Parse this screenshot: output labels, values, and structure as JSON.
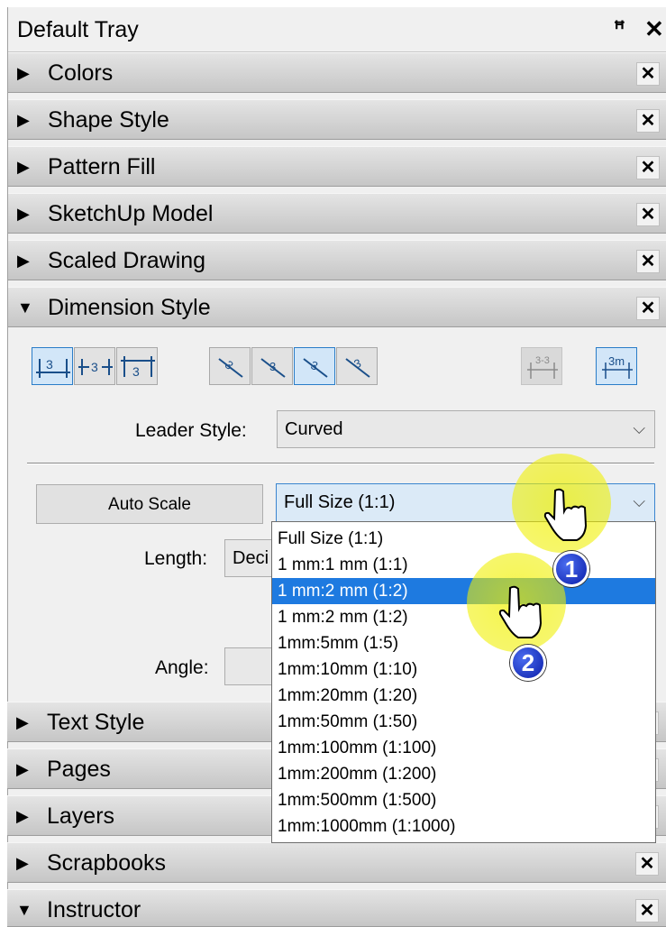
{
  "tray": {
    "title": "Default Tray",
    "pin_icon": "pin-icon",
    "close_icon": "close-icon"
  },
  "panels_top": [
    {
      "label": "Colors",
      "state": "collapsed"
    },
    {
      "label": "Shape Style",
      "state": "collapsed"
    },
    {
      "label": "Pattern Fill",
      "state": "collapsed"
    },
    {
      "label": "SketchUp Model",
      "state": "collapsed"
    },
    {
      "label": "Scaled Drawing",
      "state": "collapsed"
    },
    {
      "label": "Dimension Style",
      "state": "expanded"
    }
  ],
  "dimension_style": {
    "text_position_buttons": [
      "above-line-icon",
      "in-line-icon",
      "below-line-icon"
    ],
    "text_alignment_buttons": [
      "align-perpendicular-icon",
      "align-aligned-icon",
      "align-horizontal-icon",
      "align-vertical-icon"
    ],
    "extra_buttons": [
      "hide-dimension-line-icon",
      "show-units-icon"
    ],
    "leader_style_label": "Leader Style:",
    "leader_style_value": "Curved",
    "auto_scale_label": "Auto Scale",
    "scale_value": "Full Size (1:1)",
    "length_label": "Length:",
    "length_value": "Deci",
    "angle_label": "Angle:"
  },
  "scale_options": [
    "Full Size (1:1)",
    "1 mm:1 mm (1:1)",
    "1 mm:2 mm (1:2)",
    "1 mm:2 mm (1:2)",
    "1mm:5mm (1:5)",
    "1mm:10mm (1:10)",
    "1mm:20mm (1:20)",
    "1mm:50mm (1:50)",
    "1mm:100mm (1:100)",
    "1mm:200mm (1:200)",
    "1mm:500mm (1:500)",
    "1mm:1000mm (1:1000)"
  ],
  "highlighted_option_index": 2,
  "panels_bottom": [
    {
      "label": "Text Style",
      "state": "collapsed"
    },
    {
      "label": "Pages",
      "state": "collapsed"
    },
    {
      "label": "Layers",
      "state": "collapsed"
    },
    {
      "label": "Scrapbooks",
      "state": "collapsed"
    },
    {
      "label": "Instructor",
      "state": "expanded"
    }
  ],
  "annotations": [
    {
      "number": "1"
    },
    {
      "number": "2"
    }
  ],
  "glyphs": {
    "collapsed": "▶",
    "expanded": "▼",
    "close": "✕",
    "chevron": "⌵"
  },
  "colors": {
    "highlight": "#1e7ae0",
    "cursor_ring": "#f0f000",
    "badge": "#0a1da8"
  }
}
